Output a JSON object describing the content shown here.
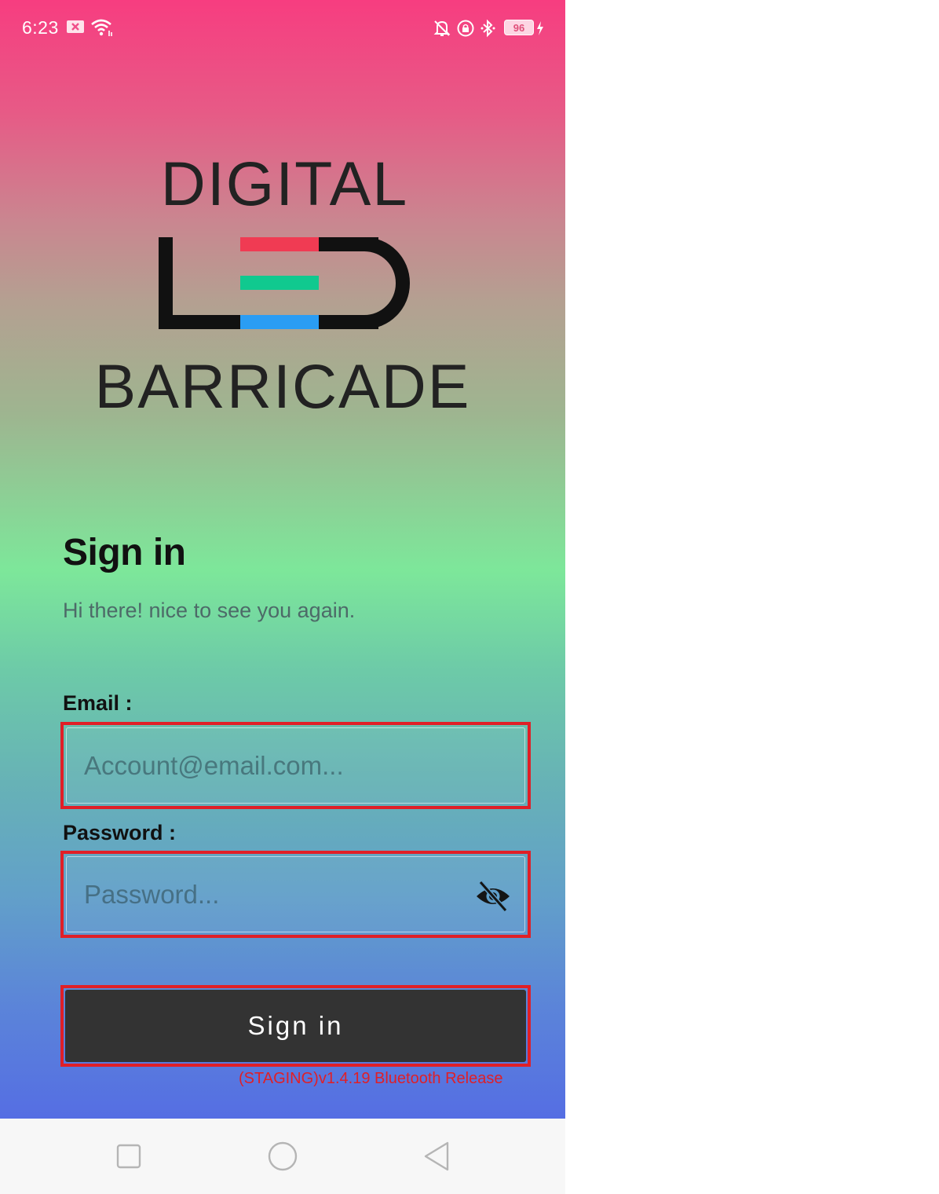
{
  "status_bar": {
    "time": "6:23",
    "battery_level": "96",
    "icons": [
      "mail-icon",
      "wifi-icon",
      "mute-icon",
      "lock-rotation-icon",
      "bluetooth-icon",
      "battery-icon",
      "charging-icon"
    ]
  },
  "logo": {
    "top_text": "DIGITAL",
    "bottom_text": "BARRICADE",
    "colors": {
      "red": "#f03b53",
      "green": "#10c98f",
      "blue": "#2a9df4"
    }
  },
  "signin": {
    "title": "Sign in",
    "subtitle": "Hi there! nice to see you again.",
    "email_label": "Email :",
    "email_placeholder": "Account@email.com...",
    "password_label": "Password :",
    "password_placeholder": "Password...",
    "button_label": "Sign in",
    "version": "(STAGING)v1.4.19 Bluetooth Release"
  },
  "theme": {
    "gradient_top": "#f73d80",
    "gradient_middle": "#7de79a",
    "gradient_bottom": "#556ee3",
    "highlight": "#e01f27",
    "button": "#333333"
  },
  "nav_bar": {
    "buttons": [
      "recent-apps-icon",
      "home-icon",
      "back-icon"
    ]
  }
}
